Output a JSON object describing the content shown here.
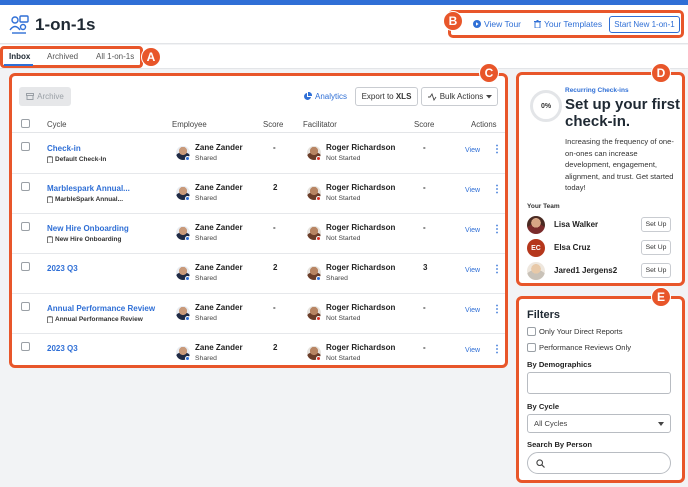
{
  "header": {
    "title": "1-on-1s",
    "view_tour": "View Tour",
    "your_templates": "Your Templates",
    "start_new": "Start New 1-on-1"
  },
  "tabs": [
    {
      "label": "Inbox",
      "active": true
    },
    {
      "label": "Archived",
      "active": false
    },
    {
      "label": "All 1-on-1s",
      "active": false
    }
  ],
  "badges": [
    "A",
    "B",
    "C",
    "D",
    "E"
  ],
  "toolbar": {
    "archive": "Archive",
    "analytics": "Analytics",
    "export_prefix": "Export to ",
    "export_format": "XLS",
    "bulk_actions": "Bulk Actions"
  },
  "table": {
    "columns": [
      "Cycle",
      "Employee",
      "Score",
      "Facilitator",
      "Score",
      "Actions"
    ],
    "rows": [
      {
        "cycle": "Check-in",
        "template": "Default Check-In",
        "employee": "Zane Zander",
        "employee_status": "Shared",
        "employee_score": "-",
        "facilitator": "Roger Richardson",
        "facilitator_status": "Not Started",
        "facilitator_score": "-",
        "action": "View"
      },
      {
        "cycle": "Marblespark Annual...",
        "template": "MarbleSpark Annual...",
        "employee": "Zane Zander",
        "employee_status": "Shared",
        "employee_score": "2",
        "facilitator": "Roger Richardson",
        "facilitator_status": "Not Started",
        "facilitator_score": "-",
        "action": "View"
      },
      {
        "cycle": "New Hire Onboarding",
        "template": "New Hire Onboarding",
        "employee": "Zane Zander",
        "employee_status": "Shared",
        "employee_score": "-",
        "facilitator": "Roger Richardson",
        "facilitator_status": "Not Started",
        "facilitator_score": "-",
        "action": "View"
      },
      {
        "cycle": "2023 Q3",
        "template": "",
        "employee": "Zane Zander",
        "employee_status": "Shared",
        "employee_score": "2",
        "facilitator": "Roger Richardson",
        "facilitator_status": "Shared",
        "facilitator_score": "3",
        "action": "View"
      },
      {
        "cycle": "Annual Performance Review",
        "template": "Annual Performance Review",
        "employee": "Zane Zander",
        "employee_status": "Shared",
        "employee_score": "-",
        "facilitator": "Roger Richardson",
        "facilitator_status": "Not Started",
        "facilitator_score": "-",
        "action": "View"
      },
      {
        "cycle": "2023 Q3",
        "template": "",
        "employee": "Zane Zander",
        "employee_status": "Shared",
        "employee_score": "2",
        "facilitator": "Roger Richardson",
        "facilitator_status": "Not Started",
        "facilitator_score": "-",
        "action": "View"
      }
    ]
  },
  "recurring": {
    "progress": "0%",
    "label": "Recurring Check-ins",
    "title": "Set up your first check-in.",
    "description": "Increasing the frequency of one-on-ones can increase development, engagement, alignment, and trust. Get started today!",
    "team_label": "Your Team",
    "team": [
      {
        "name": "Lisa Walker",
        "initials": "",
        "action": "Set Up"
      },
      {
        "name": "Elsa Cruz",
        "initials": "EC",
        "action": "Set Up"
      },
      {
        "name": "Jared1 Jergens2",
        "initials": "",
        "action": "Set Up"
      }
    ]
  },
  "filters": {
    "title": "Filters",
    "direct_reports": "Only Your Direct Reports",
    "performance_reviews": "Performance Reviews Only",
    "demographics_label": "By Demographics",
    "cycle_label": "By Cycle",
    "cycle_value": "All Cycles",
    "person_label": "Search By Person"
  },
  "colors": {
    "accent": "#2f6fd6",
    "highlight": "#e8562a"
  }
}
